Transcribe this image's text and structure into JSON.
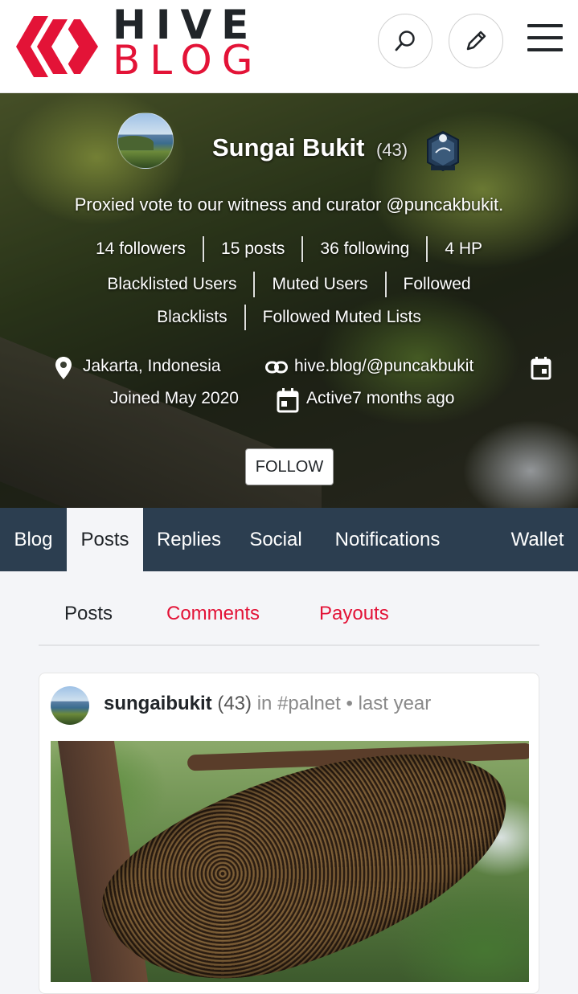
{
  "header": {
    "logo_top": "HIVE",
    "logo_bottom": "BLOG",
    "brand_color": "#e31337"
  },
  "profile": {
    "name": "Sungai Bukit",
    "reputation": "(43)",
    "about": "Proxied vote to our witness and curator @puncakbukit.",
    "followers": "14 followers",
    "posts": "15 posts",
    "following": "36 following",
    "hp": "4 HP",
    "blacklisted_users": "Blacklisted Users",
    "muted_users": "Muted Users",
    "followed_blacklists_part1": "Followed",
    "followed_blacklists_part2": "Blacklists",
    "followed_muted_lists": "Followed Muted Lists",
    "location": "Jakarta, Indonesia",
    "website": "hive.blog/@puncakbukit",
    "joined": "Joined May 2020",
    "active": "Active7 months ago",
    "follow_label": "FOLLOW"
  },
  "tabs": [
    {
      "label": "Blog",
      "active": false
    },
    {
      "label": "Posts",
      "active": true
    },
    {
      "label": "Replies",
      "active": false
    },
    {
      "label": "Social",
      "active": false
    },
    {
      "label": "Notifications",
      "active": false
    },
    {
      "label": "Wallet",
      "active": false
    }
  ],
  "subtabs": [
    {
      "label": "Posts",
      "active": true
    },
    {
      "label": "Comments",
      "active": false
    },
    {
      "label": "Payouts",
      "active": false
    }
  ],
  "post": {
    "author": "sungaibukit",
    "reputation": "(43)",
    "in_text": "in",
    "community": "#palnet",
    "separator": "•",
    "time": "last year"
  },
  "colors": {
    "nav_bg": "#2c3e50",
    "accent": "#e31337"
  }
}
